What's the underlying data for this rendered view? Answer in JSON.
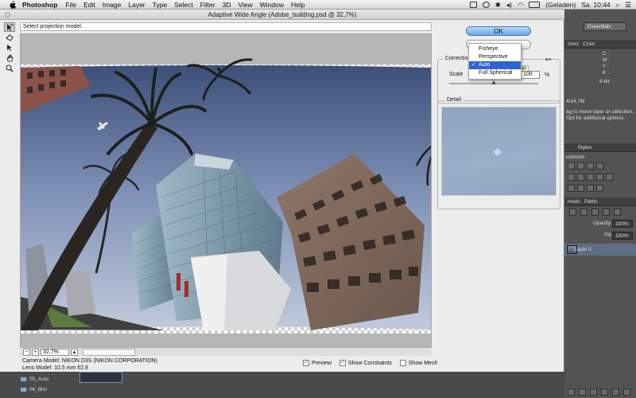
{
  "menubar": {
    "app_name": "Photoshop",
    "menus": [
      "File",
      "Edit",
      "Image",
      "Layer",
      "Type",
      "Select",
      "Filter",
      "3D",
      "View",
      "Window",
      "Help"
    ],
    "battery_status": "(Geladen)",
    "clock": "Sa. 10:44"
  },
  "dialog": {
    "title": "Adaptive Wide Angle (Adobe_building.psd @ 32,7%)",
    "status_message": "Select projection model.",
    "ok_label": "OK",
    "cancel_label": "",
    "correction_label": "Correction",
    "projection_options": [
      "Fisheye",
      "Perspective",
      "Auto",
      "Full Spherical"
    ],
    "selected_projection": "Auto",
    "scale_label": "Scale",
    "scale_value": "100",
    "scale_unit": "%",
    "scale_fraction": 0.5,
    "tooltip_text": "el",
    "detail_label": "Detail",
    "zoom_minus": "−",
    "zoom_plus": "+",
    "zoom_value": "32,7%",
    "camera_model": "Camera Model: NIKON D3S (NIKON CORPORATION)",
    "lens_model": "Lens Model: 10.5 mm f/2.8",
    "preview_label": "Preview",
    "preview_checked": true,
    "show_constraints_label": "Show Constraints",
    "show_constraints_checked": true,
    "show_mesh_label": "Show Mesh",
    "show_mesh_checked": false,
    "tools": [
      "constraint-tool-icon",
      "polygon-constraint-tool-icon",
      "move-tool-icon",
      "hand-tool-icon",
      "zoom-tool-icon"
    ]
  },
  "ps_panels": {
    "workspace": "Essentials",
    "tab_swatches": "ches",
    "tab_color": "Color",
    "info_labels": [
      "C :",
      "M :",
      "Y :",
      "K :",
      "8-bit"
    ],
    "doc_size": "4/14,7M",
    "hint_line1": "ag to move layer or selection.",
    "hint_line2": "Opt for additional options.",
    "tab_styles": "Styles",
    "adjustments_title": "ustment",
    "tab_channels": "nnels",
    "tab_paths": "Paths",
    "opacity_label": "Opacity:",
    "opacity_value": "100%",
    "fill_label": "Fill:",
    "fill_value": "100%",
    "layer_name": "Layer 0"
  },
  "ps_bottom": {
    "folders": [
      "05_Auto",
      "06_Blur"
    ]
  },
  "colors": {
    "accent_blue": "#2f63d6",
    "ok_button": "#6aa7ec",
    "ps_panel": "#535353",
    "tooltip": "#fffbc8"
  }
}
